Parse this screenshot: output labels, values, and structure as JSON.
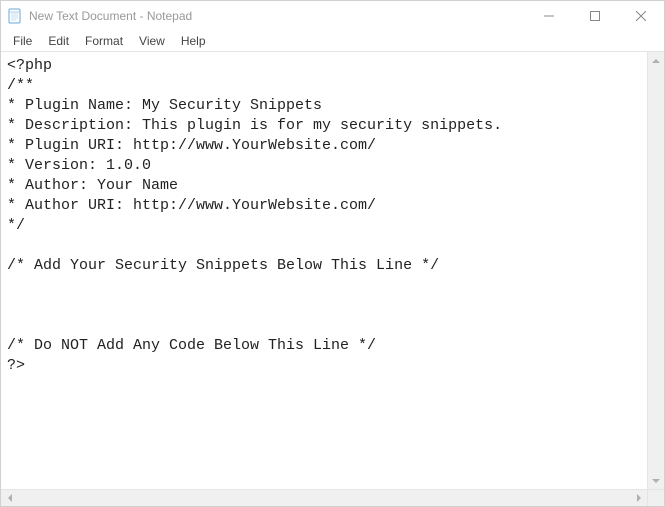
{
  "title": "New Text Document - Notepad",
  "menu": {
    "file": "File",
    "edit": "Edit",
    "format": "Format",
    "view": "View",
    "help": "Help"
  },
  "lines": [
    "<?php",
    "/**",
    "* Plugin Name: My Security Snippets",
    "* Description: This plugin is for my security snippets.",
    "* Plugin URI: http://www.YourWebsite.com/",
    "* Version: 1.0.0",
    "* Author: Your Name",
    "* Author URI: http://www.YourWebsite.com/",
    "*/",
    "",
    "/* Add Your Security Snippets Below This Line */",
    "",
    "",
    "",
    "/* Do NOT Add Any Code Below This Line */",
    "?>"
  ]
}
